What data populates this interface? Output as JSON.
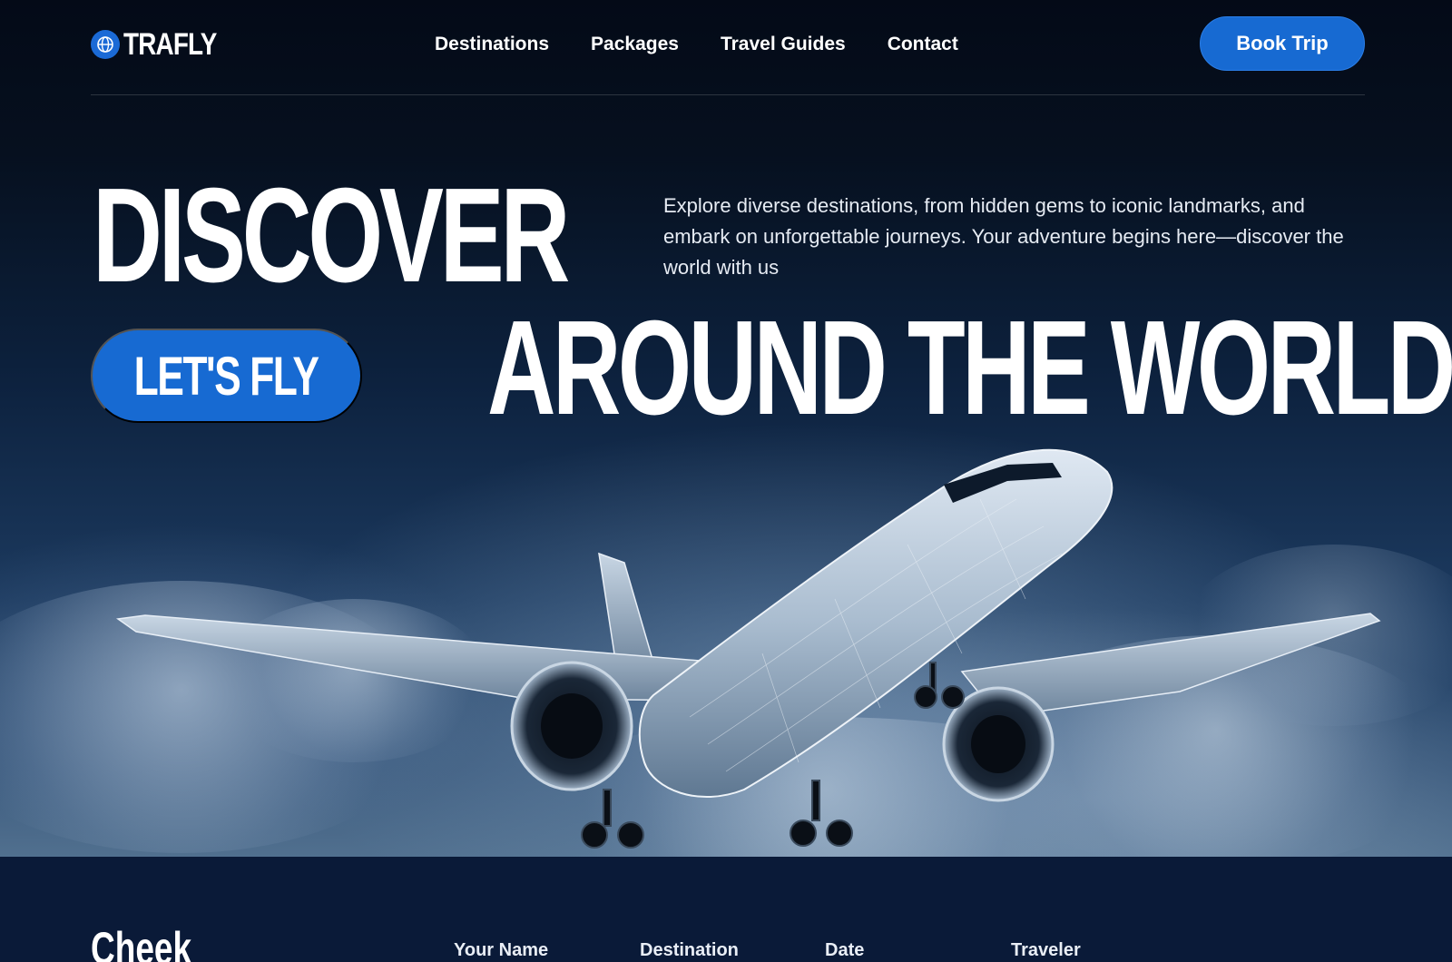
{
  "brand": {
    "name": "TRAFLY",
    "logo_icon": "globe-icon",
    "accent": "#176ad2"
  },
  "nav": {
    "links": [
      "Destinations",
      "Packages",
      "Travel Guides",
      "Contact"
    ],
    "cta": "Book Trip"
  },
  "hero": {
    "headline_1": "DISCOVER",
    "headline_2": "AROUND THE WORLD",
    "intro": "Explore diverse destinations, from hidden gems to iconic landmarks, and embark on unforgettable journeys. Your adventure begins here—discover the world with us",
    "cta": "LET'S FLY"
  },
  "booking": {
    "title": "Cheek",
    "fields": [
      "Your Name",
      "Destination",
      "Date",
      "Traveler"
    ]
  }
}
